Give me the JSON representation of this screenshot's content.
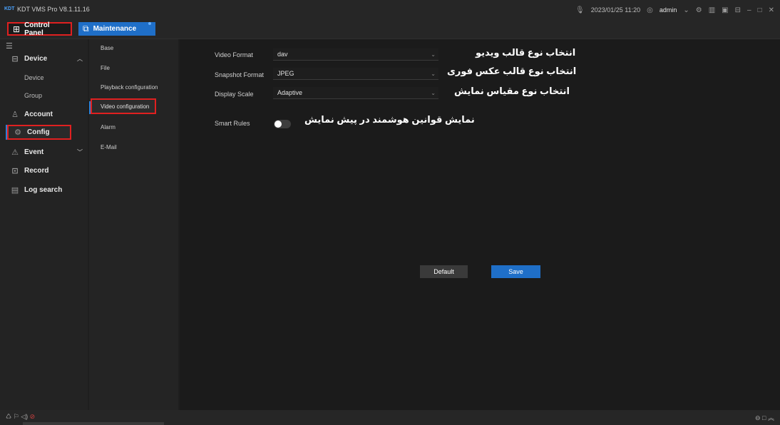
{
  "titlebar": {
    "title": "KDT VMS Pro V8.1.11.16",
    "logo": "KDT",
    "datetime": "2023/01/25 11:20",
    "user": "admin",
    "icons": [
      "microphone-icon",
      "settings-icon",
      "chart-icon",
      "screen-icon",
      "lock-icon",
      "minimize-icon",
      "maximize-icon",
      "close-icon"
    ]
  },
  "tabs": {
    "control_panel": "Control Panel",
    "maintenance": "Maintenance"
  },
  "sidebar": {
    "device": "Device",
    "device_sub": "Device",
    "group": "Group",
    "account": "Account",
    "config": "Config",
    "event": "Event",
    "record": "Record",
    "log_search": "Log search"
  },
  "submenu": {
    "base": "Base",
    "file": "File",
    "playback": "Playback configuration",
    "video": "Video configuration",
    "alarm": "Alarm",
    "email": "E-Mail"
  },
  "form": {
    "video_format_label": "Video Format",
    "video_format_value": "dav",
    "snapshot_format_label": "Snapshot Format",
    "snapshot_format_value": "JPEG",
    "display_scale_label": "Display Scale",
    "display_scale_value": "Adaptive",
    "smart_rules_label": "Smart Rules",
    "smart_rules_on": false
  },
  "annotations": {
    "video_format": "انتخاب نوع قالب ویدیو",
    "snapshot_format": "انتخاب نوع قالب عکس فوری",
    "display_scale": "انتخاب نوع مقیاس نمایش",
    "smart_rules": "نمایش قوانین هوشمند در پیش نمایش"
  },
  "buttons": {
    "default": "Default",
    "save": "Save"
  },
  "colors": {
    "accent": "#1f6fc8",
    "highlight": "#e02020"
  }
}
